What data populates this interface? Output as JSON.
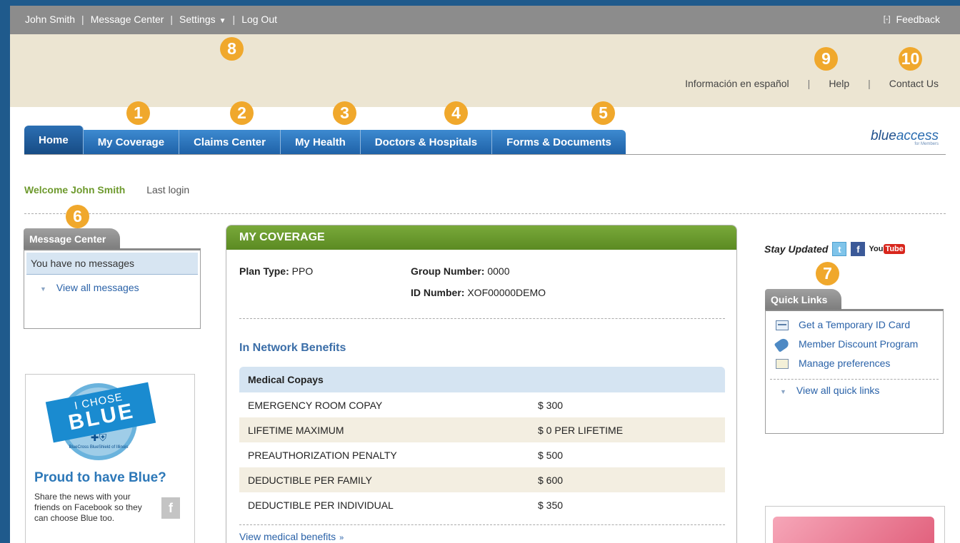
{
  "topbar": {
    "user": "John Smith",
    "sep": "|",
    "message_center": "Message Center",
    "settings": "Settings",
    "caret": "▼",
    "logout": "Log Out",
    "feedback_icon": "[-]",
    "feedback": "Feedback"
  },
  "utility": {
    "spanish": "Información en español",
    "sep": "|",
    "help": "Help",
    "contact": "Contact Us"
  },
  "badges": [
    "1",
    "2",
    "3",
    "4",
    "5",
    "6",
    "7",
    "8",
    "9",
    "10"
  ],
  "nav": {
    "home": "Home",
    "my_coverage": "My Coverage",
    "claims": "Claims Center",
    "my_health": "My Health",
    "doctors": "Doctors & Hospitals",
    "forms": "Forms & Documents"
  },
  "logo": {
    "word_a": "blue",
    "word_b": "access",
    "sub": "for Members"
  },
  "welcome": {
    "greeting": "Welcome John Smith",
    "last_login": "Last login"
  },
  "message_center": {
    "title": "Message Center",
    "no_messages": "You have no messages",
    "view_all": "View all messages"
  },
  "promo": {
    "line1": "I CHOSE",
    "line2": "BLUE",
    "org": "BlueCross BlueShield of Illinois",
    "title": "Proud to have Blue?",
    "body": "Share the news with your friends on Facebook so they can choose Blue too.",
    "fb": "f"
  },
  "coverage": {
    "title": "MY COVERAGE",
    "plan_label": "Plan Type:",
    "plan_value": "PPO",
    "group_label": "Group Number:",
    "group_value": "0000",
    "id_label": "ID Number:",
    "id_value": "XOF00000DEMO",
    "network_heading": "In Network Benefits",
    "table_header": "Medical Copays",
    "rows": [
      {
        "label": "EMERGENCY ROOM COPAY",
        "value": "$ 300"
      },
      {
        "label": "LIFETIME MAXIMUM",
        "value": "$ 0 PER LIFETIME"
      },
      {
        "label": "PREAUTHORIZATION PENALTY",
        "value": "$ 500"
      },
      {
        "label": "DEDUCTIBLE PER FAMILY",
        "value": "$ 600"
      },
      {
        "label": "DEDUCTIBLE PER INDIVIDUAL",
        "value": "$ 350"
      }
    ],
    "view_medical": "View medical benefits",
    "raquo": "»"
  },
  "stay_updated": {
    "label": "Stay Updated",
    "twitter": "t",
    "facebook": "f",
    "yt_a": "You",
    "yt_b": "Tube"
  },
  "quick_links": {
    "title": "Quick Links",
    "items": [
      {
        "label": "Get a Temporary ID Card",
        "icon": "id-card-icon"
      },
      {
        "label": "Member Discount Program",
        "icon": "discount-tag-icon"
      },
      {
        "label": "Manage preferences",
        "icon": "preferences-icon"
      }
    ],
    "view_all": "View all quick links"
  },
  "colors": {
    "nav_blue": "#1f62a8",
    "coverage_green": "#5b8a22",
    "badge_orange": "#f0a82c",
    "welcome_green": "#6e9a2e",
    "link_blue": "#2a62a8"
  }
}
